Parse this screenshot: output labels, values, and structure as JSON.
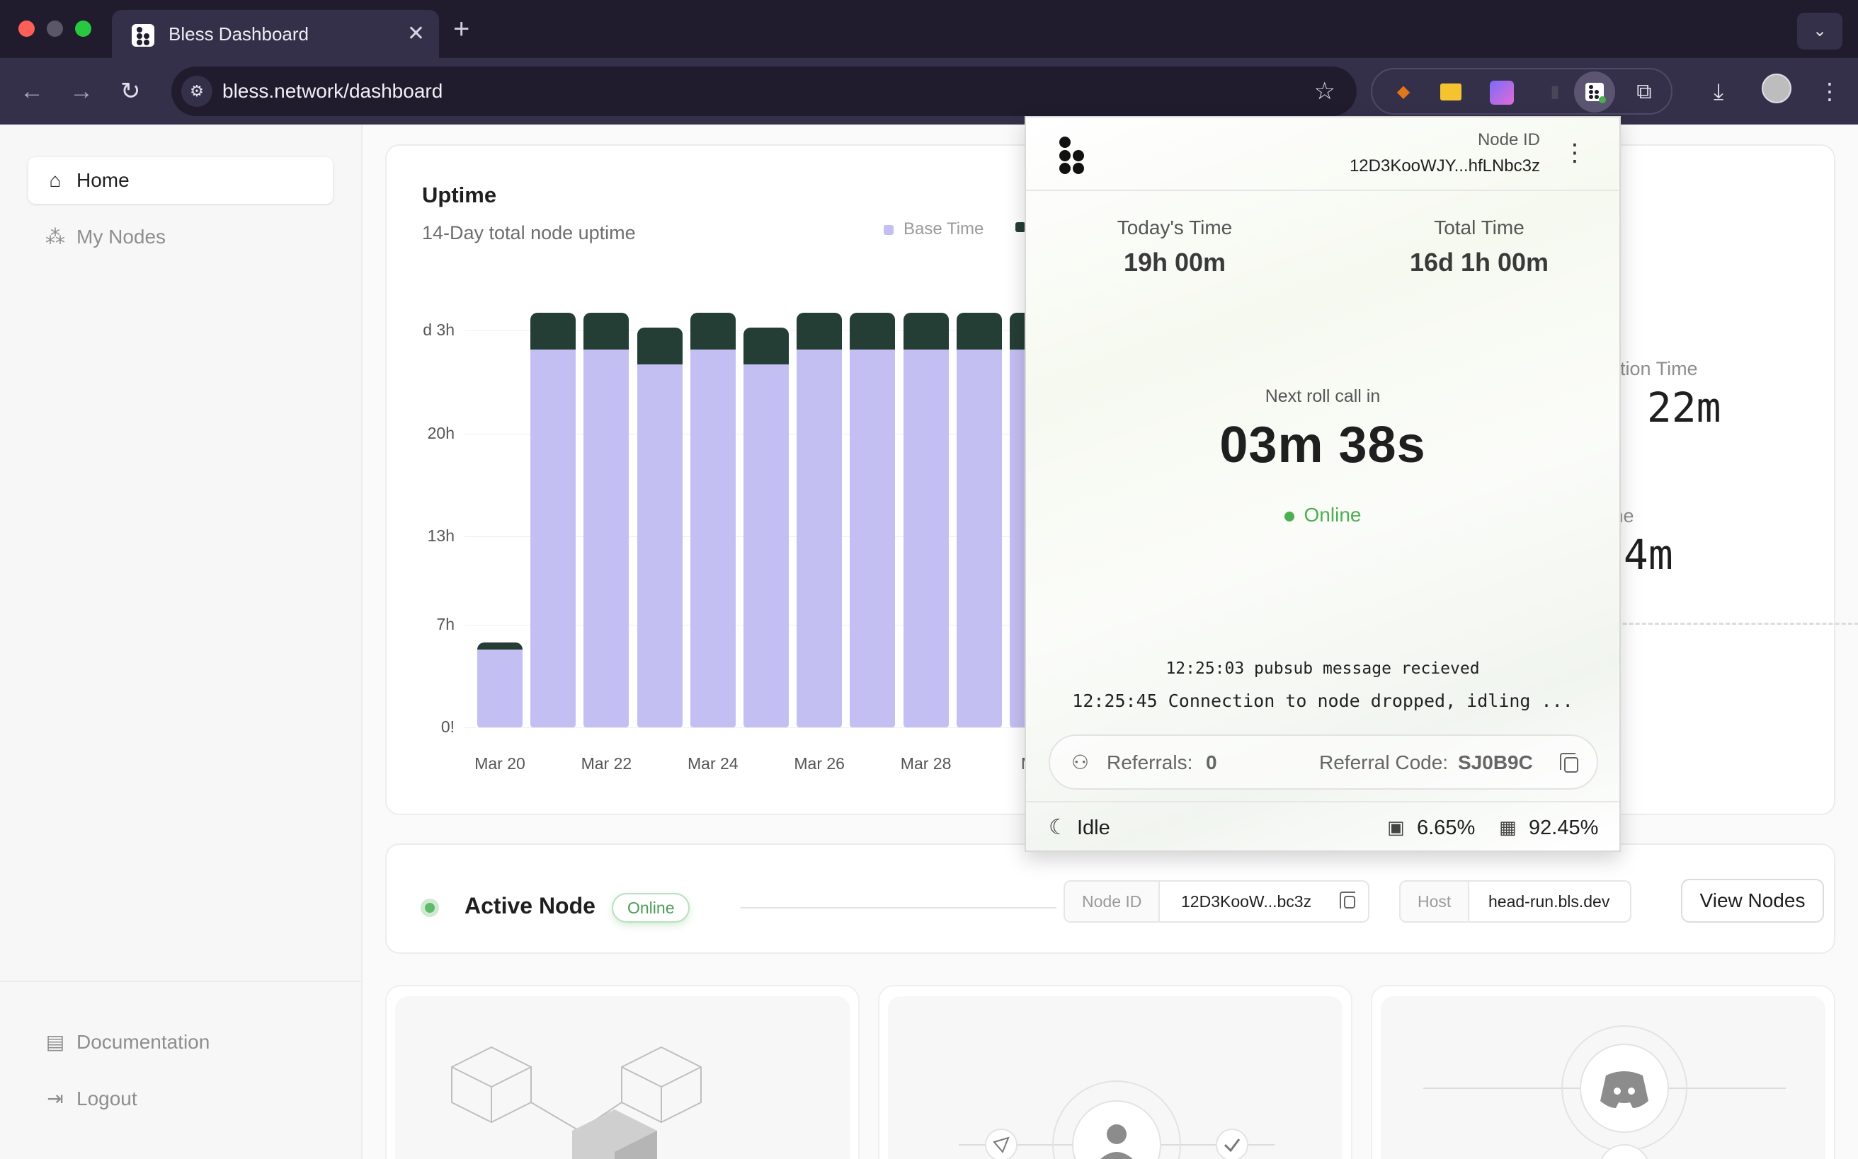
{
  "browser": {
    "tab_title": "Bless Dashboard",
    "tab_close": "✕",
    "new_tab": "+",
    "url": "bless.network/dashboard",
    "back": "←",
    "forward": "→",
    "reload": "↻",
    "star": "☆",
    "extensions": [
      "fox-extension-icon",
      "folder-extension-icon",
      "eyedropper-extension-icon",
      "trash-extension-icon",
      "bless-extension-icon",
      "puzzle-extension-icon"
    ],
    "menu": "⋮"
  },
  "sidebar": {
    "items": [
      {
        "label": "Home",
        "icon": "house-icon"
      },
      {
        "label": "My Nodes",
        "icon": "nodes-icon"
      }
    ],
    "bottom_items": [
      {
        "label": "Documentation",
        "icon": "doc-icon"
      },
      {
        "label": "Logout",
        "icon": "logout-icon"
      }
    ]
  },
  "uptime": {
    "title": "Uptime",
    "subtitle": "14-Day total node uptime",
    "legend_base": "Base Time"
  },
  "chart_data": {
    "type": "bar",
    "title": "Uptime",
    "subtitle": "14-Day total node uptime",
    "y_ticks": [
      "0!",
      "7h",
      "13h",
      "20h",
      "d 3h"
    ],
    "x_ticks": [
      "Mar 20",
      "Mar 22",
      "Mar 24",
      "Mar 26",
      "Mar 28",
      "Ma"
    ],
    "categories": [
      "Mar 20",
      "Mar 21",
      "Mar 22",
      "Mar 23",
      "Mar 24",
      "Mar 25",
      "Mar 26",
      "Mar 27",
      "Mar 28",
      "Mar 29",
      "Mar 30"
    ],
    "series": [
      {
        "name": "Base Time",
        "color": "#c4bff2",
        "values": [
          5.3,
          25.7,
          25.7,
          24.7,
          25.7,
          24.7,
          25.7,
          25.7,
          25.7,
          25.7,
          25.7
        ]
      },
      {
        "color": "#243e36",
        "values": [
          0.5,
          2.5,
          2.5,
          2.5,
          2.5,
          2.5,
          2.5,
          2.5,
          2.5,
          2.5,
          2.5
        ]
      }
    ],
    "ylim": [
      0,
      28.5
    ],
    "grid": true,
    "legend_position": "top-right"
  },
  "right_stats": {
    "occupation_label": "pation Time",
    "occupation_value": "h 22m",
    "other_label": "me",
    "other_value": "54m"
  },
  "active_node": {
    "title": "Active Node",
    "badge": "Online",
    "node_id_key": "Node ID",
    "node_id_val": "12D3KooW...bc3z",
    "host_key": "Host",
    "host_val": "head-run.bls.dev",
    "view_button": "View Nodes"
  },
  "popup": {
    "node_id_label": "Node ID",
    "node_id": "12D3KooWJY...hfLNbc3z",
    "menu": "⋮",
    "today_label": "Today's Time",
    "today_value": "19h 00m",
    "total_label": "Total Time",
    "total_value": "16d 1h 00m",
    "roll_label": "Next roll call in",
    "roll_value": "03m 38s",
    "status": "Online",
    "log_1": "12:25:03 pubsub message recieved",
    "log_2": "12:25:45 Connection to node dropped, idling ...",
    "referrals_label": "Referrals:",
    "referrals_value": "0",
    "referral_code_label": "Referral Code:",
    "referral_code": "SJ0B9C",
    "idle": "Idle",
    "cpu": "6.65%",
    "memory": "92.45%"
  }
}
